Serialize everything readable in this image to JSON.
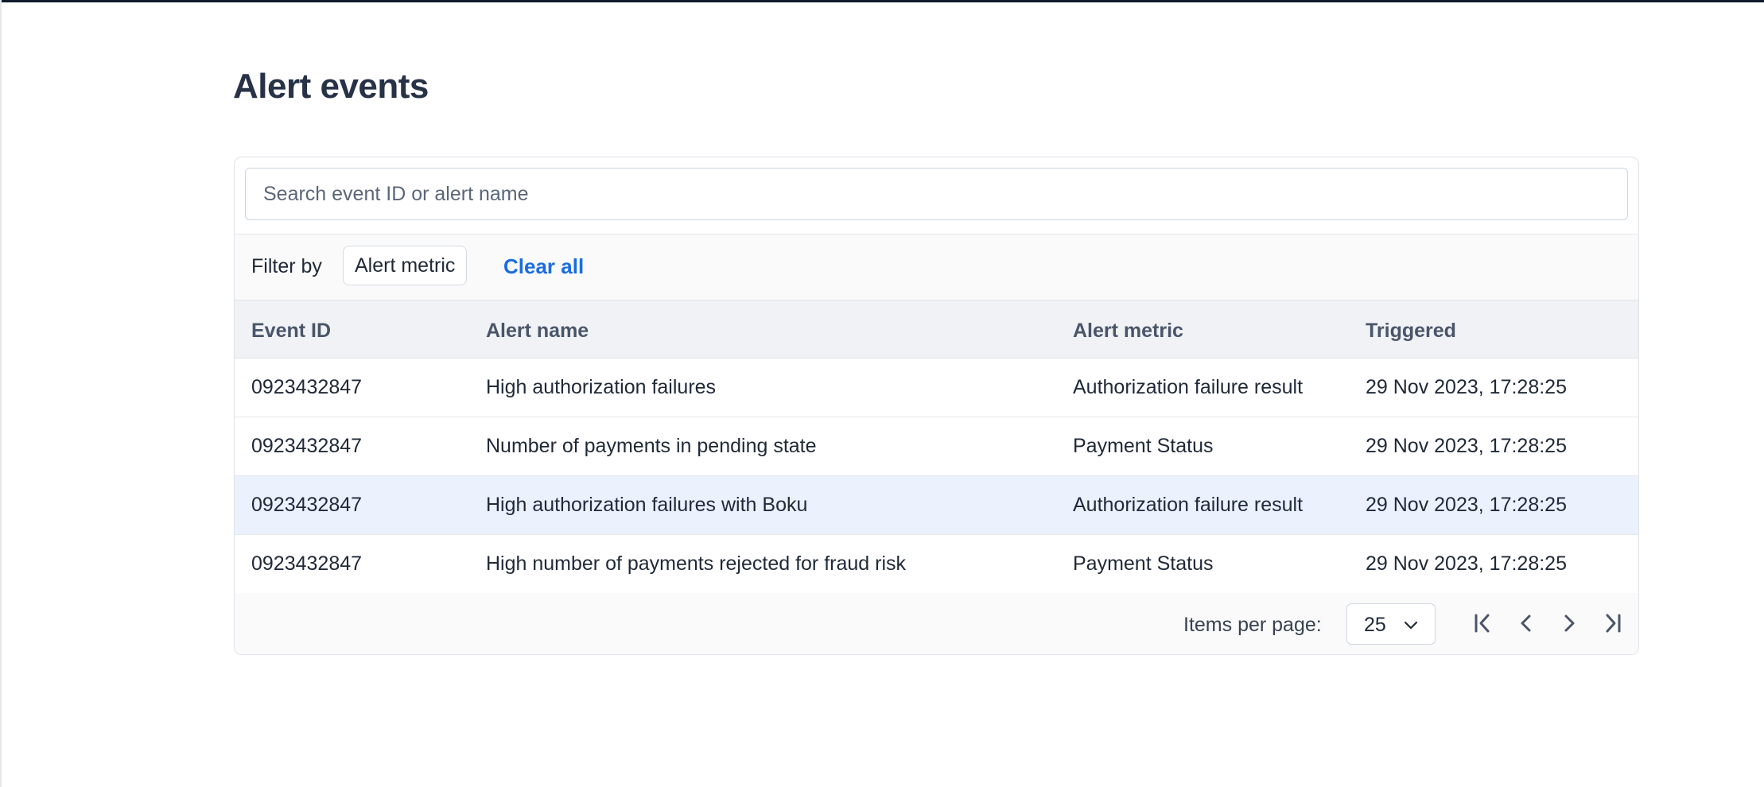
{
  "page": {
    "title": "Alert events"
  },
  "search": {
    "placeholder": "Search event ID or alert name",
    "value": ""
  },
  "filters": {
    "label": "Filter by",
    "chips": [
      "Alert metric"
    ],
    "clear_label": "Clear all"
  },
  "table": {
    "columns": [
      "Event ID",
      "Alert name",
      "Alert metric",
      "Triggered"
    ],
    "rows": [
      {
        "event_id": "0923432847",
        "alert_name": "High authorization failures",
        "alert_metric": "Authorization failure result",
        "triggered": "29 Nov 2023, 17:28:25"
      },
      {
        "event_id": "0923432847",
        "alert_name": "Number of payments in pending state",
        "alert_metric": "Payment Status",
        "triggered": "29 Nov 2023, 17:28:25"
      },
      {
        "event_id": "0923432847",
        "alert_name": "High authorization failures with Boku",
        "alert_metric": "Authorization failure result",
        "triggered": "29 Nov 2023, 17:28:25"
      },
      {
        "event_id": "0923432847",
        "alert_name": "High number of payments rejected for fraud risk",
        "alert_metric": "Payment Status",
        "triggered": "29 Nov 2023, 17:28:25"
      }
    ]
  },
  "pagination": {
    "items_per_page_label": "Items per page:",
    "items_per_page": "25",
    "icons": [
      "first-page-icon",
      "previous-page-icon",
      "next-page-icon",
      "last-page-icon"
    ]
  },
  "colors": {
    "link": "#1a6de0",
    "title": "#273247",
    "highlight_row": "#ebf1fd",
    "header_bg": "#f0f2f5"
  }
}
